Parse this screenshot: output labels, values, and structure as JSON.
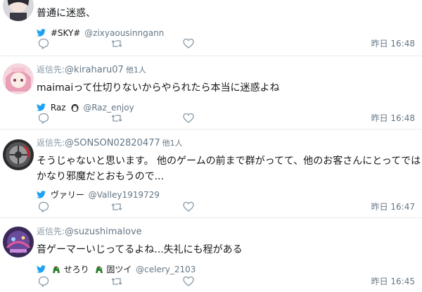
{
  "tweets": [
    {
      "reply_prefix": "",
      "reply_to": "",
      "reply_more": "",
      "text": "普通に迷惑、",
      "source_name": "#SKY#",
      "screen_name": "@zixyaousinngann",
      "time": "昨日 16:48"
    },
    {
      "reply_prefix": "返信先:",
      "reply_to": "@kiraharu07",
      "reply_more": "他1人",
      "text": "maimaiって仕切りないからやられたら本当に迷惑よね",
      "source_name": "Raz",
      "screen_name": "@Raz_enjoy",
      "time": "昨日 16:48"
    },
    {
      "reply_prefix": "返信先:",
      "reply_to": "@SONSON02820477",
      "reply_more": "他1人",
      "text_line1": "そうじゃないと思います。 他のゲームの前まで群がってて、他のお客さんにとってでは",
      "text_line2": "かなり邪魔だとおもうので...",
      "source_name": "ヴァリー",
      "screen_name": "@Valley1919729",
      "time": "昨日 16:47"
    },
    {
      "reply_prefix": "返信先:",
      "reply_to": "@suzushimalove",
      "reply_more": "",
      "text": "音ゲーマーいじってるよね...失礼にも程がある",
      "source_name_a": "せろり",
      "source_name_b": "固ツイ",
      "screen_name": "@celery_2103",
      "time": "昨日 16:45"
    }
  ],
  "colors": {
    "twitter_blue": "#1da1f2",
    "muted": "#657786",
    "text": "#14171a",
    "divider": "#e6ecf0"
  }
}
